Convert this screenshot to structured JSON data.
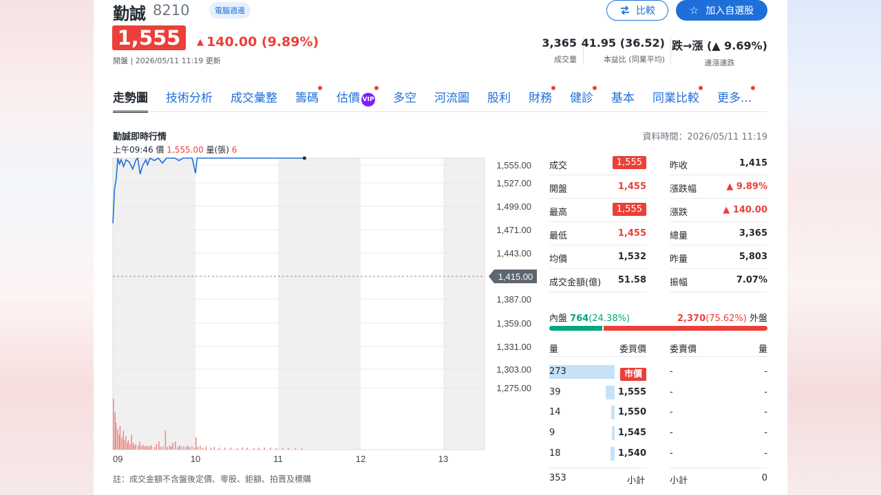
{
  "header": {
    "name": "勤誠",
    "code": "8210",
    "tag": "電腦週邊",
    "price": "1,555",
    "change": "140.00 (9.89%)",
    "meta": "開盤 | 2026/05/11 11:19 更新",
    "compare_label": "比較",
    "watchlist_label": "加入自選股",
    "kpis": [
      {
        "value": "3,365",
        "label": "成交量"
      },
      {
        "value": "41.95 (36.52)",
        "label": "本益比 (同業平均)"
      },
      {
        "value": "跌→漲 (▲ 9.69%)",
        "label": "連漲連跌"
      }
    ]
  },
  "tabs": [
    {
      "label": "走勢圖",
      "active": true,
      "dot": false
    },
    {
      "label": "技術分析",
      "active": false,
      "dot": false
    },
    {
      "label": "成交彙整",
      "active": false,
      "dot": false
    },
    {
      "label": "籌碼",
      "active": false,
      "dot": true
    },
    {
      "label": "估價",
      "active": false,
      "dot": true,
      "vip": "VIP"
    },
    {
      "label": "多空",
      "active": false,
      "dot": false
    },
    {
      "label": "河流圖",
      "active": false,
      "dot": false
    },
    {
      "label": "股利",
      "active": false,
      "dot": false
    },
    {
      "label": "財務",
      "active": false,
      "dot": true
    },
    {
      "label": "健診",
      "active": false,
      "dot": true
    },
    {
      "label": "基本",
      "active": false,
      "dot": false
    },
    {
      "label": "同業比較",
      "active": false,
      "dot": true
    },
    {
      "label": "更多...",
      "active": false,
      "dot": true
    }
  ],
  "chart_section": {
    "title": "勤誠即時行情",
    "data_time": "資料時間：2026/05/11 11:19",
    "cursor": {
      "time": "上午09:46",
      "price_label": "價",
      "price": "1,555.00",
      "vol_label": "量(張)",
      "vol": "6"
    },
    "footnote": "註：成交金額不含盤後定價、零股、鉅額、拍賣及標購"
  },
  "chart_data": {
    "type": "line",
    "x_ticks": [
      "09",
      "10",
      "11",
      "12",
      "13"
    ],
    "y_ticks": [
      "1,555.00",
      "1,527.00",
      "1,499.00",
      "1,471.00",
      "1,443.00",
      "1,415.00",
      "1,387.00",
      "1,359.00",
      "1,331.00",
      "1,303.00",
      "1,275.00"
    ],
    "ylim": [
      1275,
      1555
    ],
    "reference_price": "1,415.00",
    "reference_value": 1415,
    "x_range_hours": [
      9,
      13.5
    ],
    "price_series": [
      [
        9.0,
        1477
      ],
      [
        9.02,
        1518
      ],
      [
        9.04,
        1530
      ],
      [
        9.06,
        1555
      ],
      [
        9.08,
        1548
      ],
      [
        9.1,
        1553
      ],
      [
        9.13,
        1545
      ],
      [
        9.16,
        1553
      ],
      [
        9.2,
        1550
      ],
      [
        9.24,
        1542
      ],
      [
        9.28,
        1553
      ],
      [
        9.3,
        1555
      ],
      [
        9.33,
        1536
      ],
      [
        9.36,
        1546
      ],
      [
        9.4,
        1553
      ],
      [
        9.42,
        1547
      ],
      [
        9.45,
        1555
      ],
      [
        9.5,
        1552
      ],
      [
        9.55,
        1555
      ],
      [
        9.6,
        1549
      ],
      [
        9.65,
        1555
      ],
      [
        9.75,
        1555
      ],
      [
        9.8,
        1552
      ],
      [
        9.85,
        1555
      ],
      [
        9.92,
        1555
      ],
      [
        9.96,
        1555
      ],
      [
        10.0,
        1537
      ],
      [
        10.02,
        1555
      ],
      [
        10.3,
        1555
      ],
      [
        10.6,
        1555
      ],
      [
        11.0,
        1555
      ],
      [
        11.32,
        1555
      ]
    ],
    "volume_series": [
      [
        9.0,
        75
      ],
      [
        9.02,
        55
      ],
      [
        9.03,
        40
      ],
      [
        9.05,
        30
      ],
      [
        9.07,
        22
      ],
      [
        9.08,
        35
      ],
      [
        9.1,
        18
      ],
      [
        9.12,
        28
      ],
      [
        9.13,
        14
      ],
      [
        9.15,
        20
      ],
      [
        9.17,
        10
      ],
      [
        9.18,
        14
      ],
      [
        9.2,
        8
      ],
      [
        9.22,
        22
      ],
      [
        9.24,
        10
      ],
      [
        9.25,
        6
      ],
      [
        9.27,
        8
      ],
      [
        9.3,
        6
      ],
      [
        9.32,
        12
      ],
      [
        9.34,
        5
      ],
      [
        9.36,
        7
      ],
      [
        9.38,
        5
      ],
      [
        9.4,
        6
      ],
      [
        9.42,
        4
      ],
      [
        9.44,
        6
      ],
      [
        9.46,
        6
      ],
      [
        9.5,
        4
      ],
      [
        9.52,
        8
      ],
      [
        9.55,
        12
      ],
      [
        9.57,
        4
      ],
      [
        9.6,
        5
      ],
      [
        9.63,
        28
      ],
      [
        9.65,
        4
      ],
      [
        9.68,
        6
      ],
      [
        9.7,
        5
      ],
      [
        9.72,
        10
      ],
      [
        9.75,
        12
      ],
      [
        9.78,
        4
      ],
      [
        9.8,
        6
      ],
      [
        9.82,
        5
      ],
      [
        9.85,
        5
      ],
      [
        9.88,
        4
      ],
      [
        9.9,
        6
      ],
      [
        9.92,
        4
      ],
      [
        9.95,
        5
      ],
      [
        9.98,
        3
      ],
      [
        10.0,
        18
      ],
      [
        10.02,
        4
      ],
      [
        10.05,
        6
      ],
      [
        10.08,
        3
      ],
      [
        10.12,
        5
      ],
      [
        10.18,
        3
      ],
      [
        10.22,
        4
      ],
      [
        10.28,
        3
      ],
      [
        10.35,
        3
      ],
      [
        10.42,
        3
      ],
      [
        10.5,
        2
      ],
      [
        10.56,
        3
      ],
      [
        10.62,
        3
      ],
      [
        10.7,
        2
      ],
      [
        10.76,
        3
      ],
      [
        10.83,
        3
      ],
      [
        10.9,
        3
      ],
      [
        10.97,
        2
      ],
      [
        11.05,
        2
      ],
      [
        11.12,
        2
      ],
      [
        11.2,
        2
      ],
      [
        11.28,
        2
      ]
    ],
    "colors": {
      "line": "#1e6fd9",
      "volume": "#f08a8a",
      "shade": "#f0f0f0",
      "grid": "#e6e6e6"
    }
  },
  "quote": {
    "left": [
      {
        "label": "成交",
        "value": "1,555",
        "style": "box"
      },
      {
        "label": "開盤",
        "value": "1,455",
        "style": "red"
      },
      {
        "label": "最高",
        "value": "1,555",
        "style": "box"
      },
      {
        "label": "最低",
        "value": "1,455",
        "style": "red"
      },
      {
        "label": "均價",
        "value": "1,532",
        "style": "dark"
      },
      {
        "label": "成交金額(億)",
        "value": "51.58",
        "style": "dark"
      }
    ],
    "right": [
      {
        "label": "昨收",
        "value": "1,415",
        "style": "dark"
      },
      {
        "label": "漲跌幅",
        "value": "▲ 9.89%",
        "style": "red"
      },
      {
        "label": "漲跌",
        "value": "▲ 140.00",
        "style": "red"
      },
      {
        "label": "總量",
        "value": "3,365",
        "style": "dark"
      },
      {
        "label": "昨量",
        "value": "5,803",
        "style": "dark"
      },
      {
        "label": "振幅",
        "value": "7.07%",
        "style": "dark"
      }
    ]
  },
  "inner_outer": {
    "inner_label": "內盤",
    "inner_value": "764",
    "inner_pct": "(24.38%)",
    "outer_value": "2,370",
    "outer_pct": "(75.62%)",
    "outer_label": "外盤",
    "inner_fraction": 0.2438
  },
  "order_book": {
    "headers": {
      "qty": "量",
      "bid": "委買價",
      "ask": "委賣價",
      "ask_qty": "量"
    },
    "rows": [
      {
        "qty": "273",
        "bid": "市價",
        "ask": "-",
        "ask_qty": "-",
        "bar": 1.0,
        "market": true
      },
      {
        "qty": "39",
        "bid": "1,555",
        "ask": "-",
        "ask_qty": "-",
        "bar": 0.14,
        "market": false
      },
      {
        "qty": "14",
        "bid": "1,550",
        "ask": "-",
        "ask_qty": "-",
        "bar": 0.05,
        "market": false
      },
      {
        "qty": "9",
        "bid": "1,545",
        "ask": "-",
        "ask_qty": "-",
        "bar": 0.035,
        "market": false
      },
      {
        "qty": "18",
        "bid": "1,540",
        "ask": "-",
        "ask_qty": "-",
        "bar": 0.066,
        "market": false
      }
    ],
    "subtotal": {
      "bid_qty": "353",
      "bid_label": "小計",
      "ask_label": "小計",
      "ask_qty": "0"
    }
  },
  "colors": {
    "up": "#eb3f38",
    "down": "#00a67e",
    "link": "#1e6fd9"
  }
}
